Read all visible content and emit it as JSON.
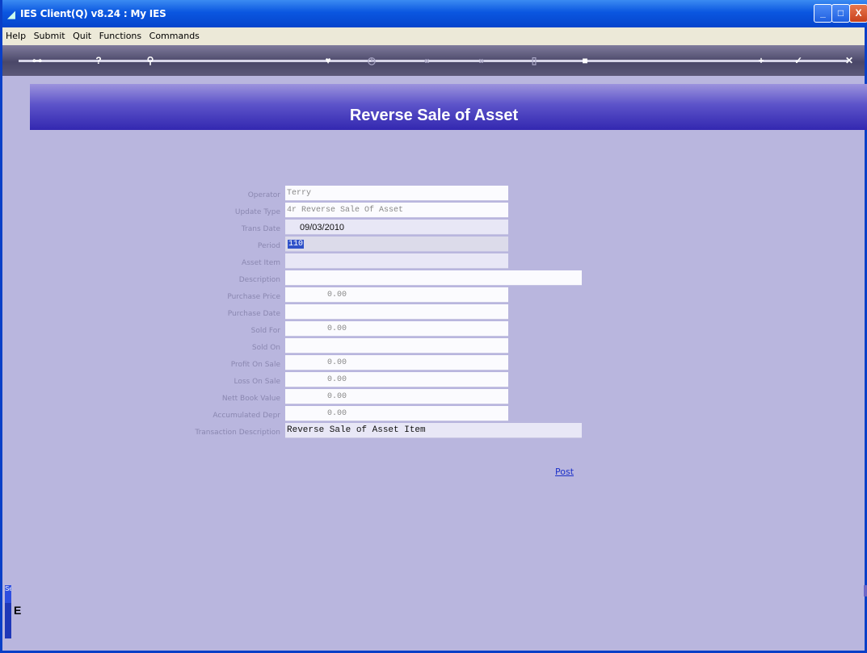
{
  "window": {
    "title": "IES Client(Q) v8.24 : My IES",
    "min_glyph": "_",
    "max_glyph": "□",
    "close_glyph": "X"
  },
  "menu": [
    "Help",
    "Submit",
    "Quit",
    "Functions",
    "Commands"
  ],
  "toolbar": {
    "icons": [
      "key-icon",
      "help-icon",
      "search-icon",
      "heart-icon",
      "clock-icon",
      "rewind-icon",
      "fast-forward-icon",
      "document-icon",
      "stop-icon",
      "add-icon",
      "check-icon",
      "close-icon"
    ],
    "glyphs": {
      "key": "⊶",
      "help": "?",
      "search": "⚲",
      "heart": "♥",
      "clock": "◷",
      "rewind": "«",
      "fast_forward": "»",
      "document": "▯",
      "stop": "■",
      "add": "+",
      "check": "✓",
      "close": "✕"
    }
  },
  "banner": {
    "title": "Reverse Sale of Asset"
  },
  "form": {
    "operator_label": "Operator",
    "operator_value": "Terry",
    "update_type_label": "Update Type",
    "update_type_value": "4r Reverse Sale Of Asset",
    "trans_date_label": "Trans Date",
    "trans_date_value": "09/03/2010",
    "period_label": "Period",
    "period_value": "110",
    "asset_item_label": "Asset Item",
    "asset_item_value": "",
    "description_label": "Description",
    "description_value": "",
    "purchase_price_label": "Purchase Price",
    "purchase_price_value": "0.00",
    "purchase_date_label": "Purchase Date",
    "purchase_date_value": "",
    "sold_for_label": "Sold For",
    "sold_for_value": "0.00",
    "sold_on_label": "Sold On",
    "sold_on_value": "",
    "profit_on_sale_label": "Profit On Sale",
    "profit_on_sale_value": "0.00",
    "loss_on_sale_label": "Loss On Sale",
    "loss_on_sale_value": "0.00",
    "nett_book_value_label": "Nett Book Value",
    "nett_book_value_value": "0.00",
    "accumulated_depr_label": "Accumulated Depr",
    "accumulated_depr_value": "0.00",
    "transaction_description_label": "Transaction Description",
    "transaction_description_value": "Reverse Sale of Asset Item"
  },
  "actions": {
    "post_label": "Post"
  },
  "side": {
    "tab_text": "Se",
    "char": "E"
  },
  "colors": {
    "background": "#b9b6de",
    "banner": "#4a40c0",
    "titlebar": "#0a56e0",
    "link": "#1c30c8"
  }
}
